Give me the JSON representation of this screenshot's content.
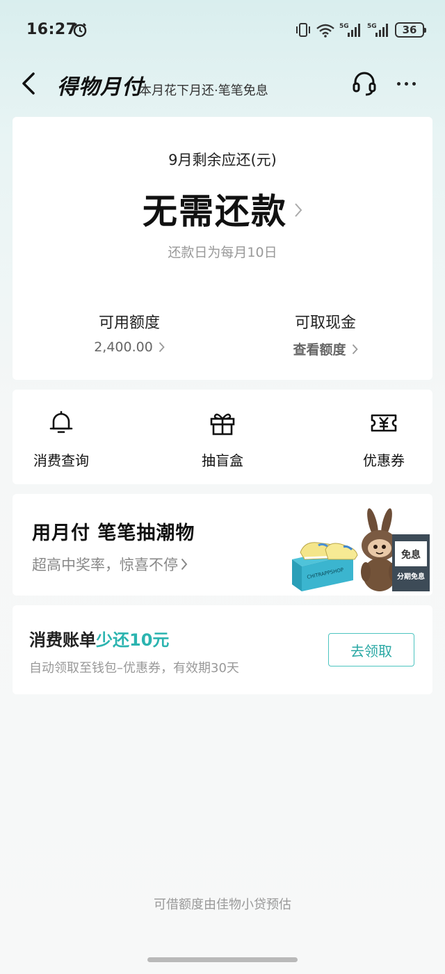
{
  "status_bar": {
    "time": "16:27",
    "battery": "36",
    "network_1": "5G",
    "network_2": "5G"
  },
  "nav": {
    "brand": "得物月付",
    "subtitle": "本月花下月还·笔笔免息"
  },
  "balance": {
    "label": "9月剩余应还(元)",
    "status": "无需还款",
    "due_note": "还款日为每月10日",
    "available_title": "可用额度",
    "available_value": "2,400.00",
    "cash_title": "可取现金",
    "cash_value": "查看额度"
  },
  "actions": [
    {
      "label": "消费查询",
      "icon": "bell-icon"
    },
    {
      "label": "抽盲盒",
      "icon": "gift-box-icon"
    },
    {
      "label": "优惠券",
      "icon": "yen-ticket-icon"
    }
  ],
  "promo": {
    "title": "用月付 笔笔抽潮物",
    "subtitle": "超高中奖率，惊喜不停",
    "tag_top": "免息",
    "tag_bottom": "分期免息",
    "box_text": "CHITRAPPSHOP"
  },
  "coupon": {
    "title_prefix": "消费账单",
    "title_highlight": "少还10元",
    "desc": "自动领取至钱包–优惠券，有效期30天",
    "button": "去领取"
  },
  "footer": {
    "note": "可借额度由佳物小贷预估"
  },
  "colors": {
    "accent": "#2bb4b0",
    "background_top": "#d9eeee",
    "background_bottom": "#f7f8f8"
  }
}
